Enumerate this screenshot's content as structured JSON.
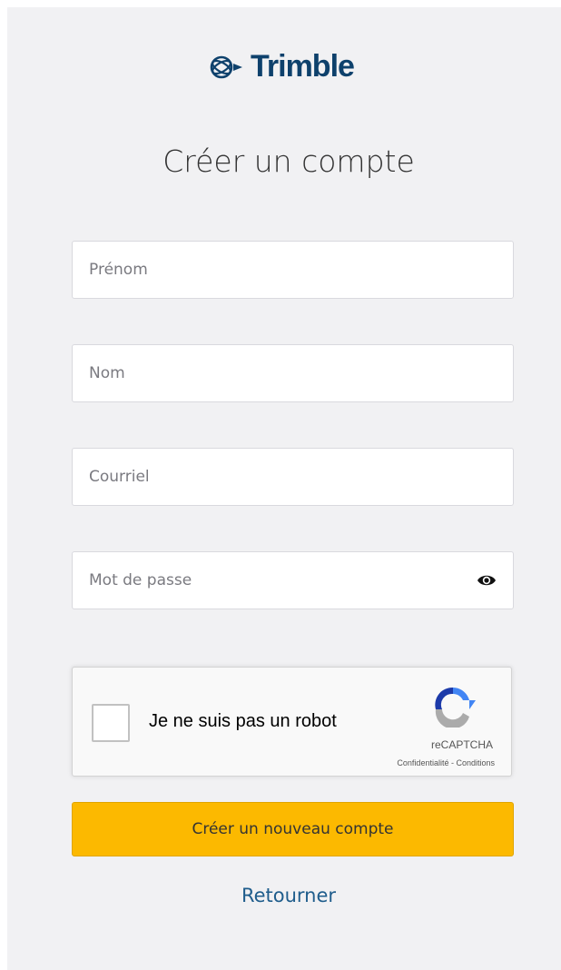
{
  "brand": {
    "name": "Trimble",
    "icon": "trimble-globe-icon",
    "color": "#0e416c"
  },
  "page": {
    "title": "Créer un compte"
  },
  "form": {
    "first_name": {
      "placeholder": "Prénom",
      "value": ""
    },
    "last_name": {
      "placeholder": "Nom",
      "value": ""
    },
    "email": {
      "placeholder": "Courriel",
      "value": ""
    },
    "password": {
      "placeholder": "Mot de passe",
      "value": "",
      "toggle_icon": "eye-icon"
    }
  },
  "captcha": {
    "label": "Je ne suis pas un robot",
    "brand": "reCAPTCHA",
    "privacy": "Confidentialité",
    "separator": " - ",
    "terms": "Conditions",
    "checked": false
  },
  "actions": {
    "submit_label": "Créer un nouveau compte",
    "submit_color": "#fcb900",
    "back_label": "Retourner",
    "back_color": "#1f5d8c"
  }
}
